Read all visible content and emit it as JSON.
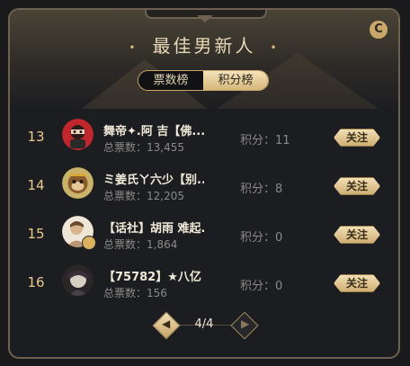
{
  "header": {
    "title": "最佳男新人",
    "dot_left": "•",
    "dot_right": "•",
    "refresh_icon_glyph": "C"
  },
  "tabs": [
    {
      "label": "票数榜",
      "active": false
    },
    {
      "label": "积分榜",
      "active": true
    }
  ],
  "rows": [
    {
      "rank": "13",
      "name": "舞帝✦.阿 吉【佛...",
      "votes_label": "总票数：",
      "votes": "13,455",
      "score_label": "积分：",
      "score": "11",
      "follow_label": "关注",
      "avatar_icon": "avatar-red-character"
    },
    {
      "rank": "14",
      "name": "ミ姜氏ㄚ六少【别...",
      "votes_label": "总票数：",
      "votes": "12,205",
      "score_label": "积分：",
      "score": "8",
      "follow_label": "关注",
      "avatar_icon": "avatar-monkey-character"
    },
    {
      "rank": "15",
      "name": "【话社】胡雨 难起...",
      "votes_label": "总票数：",
      "votes": "1,864",
      "score_label": "积分：",
      "score": "0",
      "follow_label": "关注",
      "avatar_icon": "avatar-photo-person"
    },
    {
      "rank": "16",
      "name": "【75782】★八亿",
      "votes_label": "总票数：",
      "votes": "156",
      "score_label": "积分：",
      "score": "0",
      "follow_label": "关注",
      "avatar_icon": "avatar-dark-character"
    }
  ],
  "pager": {
    "indicator": "4/4",
    "prev_glyph": "◀",
    "next_glyph": "▶"
  },
  "colors": {
    "accent_gold": "#c9a66a",
    "rank_gold": "#e8c98a",
    "panel_bg": "#1c1d21"
  }
}
